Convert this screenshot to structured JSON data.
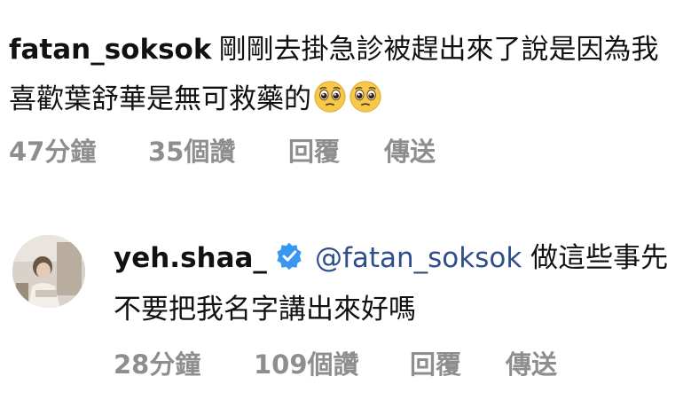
{
  "comments": [
    {
      "username": "fatan_soksok",
      "text": "剛剛去掛急診被趕出來了說是因為我喜歡葉舒華是無可救藥的",
      "emojis": [
        "pleading-face",
        "pleading-face"
      ],
      "time": "47分鐘",
      "likes": "35個讚",
      "reply": "回覆",
      "send": "傳送"
    },
    {
      "username": "yeh.shaa_",
      "verified": true,
      "mention": "@fatan_soksok",
      "text": "做這些事先不要把我名字講出來好嗎",
      "time": "28分鐘",
      "likes": "109個讚",
      "reply": "回覆",
      "send": "傳送"
    }
  ],
  "colors": {
    "text": "#111111",
    "meta": "#8e8e8e",
    "mention": "#2f4e8c",
    "verified": "#3897f0"
  }
}
